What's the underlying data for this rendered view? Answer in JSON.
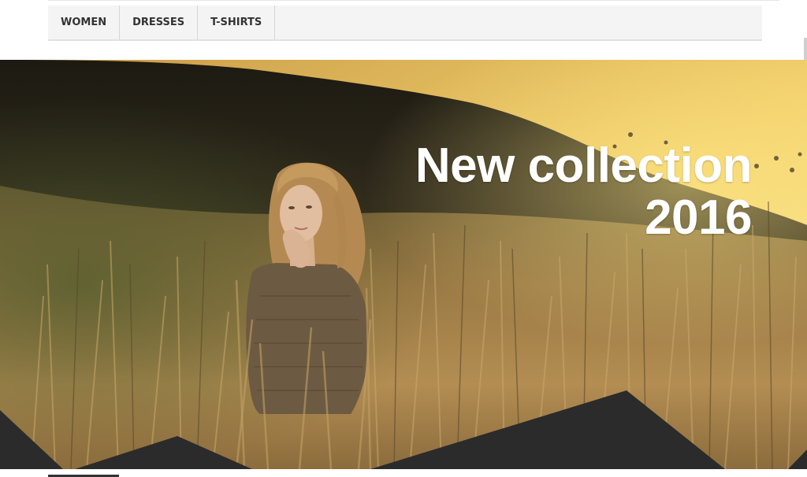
{
  "nav": {
    "items": [
      {
        "label": "WOMEN"
      },
      {
        "label": "DRESSES"
      },
      {
        "label": "T-SHIRTS"
      }
    ]
  },
  "banner": {
    "line1": "New collection",
    "line2": "2016"
  },
  "colors": {
    "nav_background": "#f4f4f4",
    "nav_text": "#333333",
    "sky": "#f6dc7a",
    "hill": "#2a2418",
    "grass": "#a9844c",
    "dark_band": "#2b2b2b",
    "headline": "#ffffff"
  }
}
